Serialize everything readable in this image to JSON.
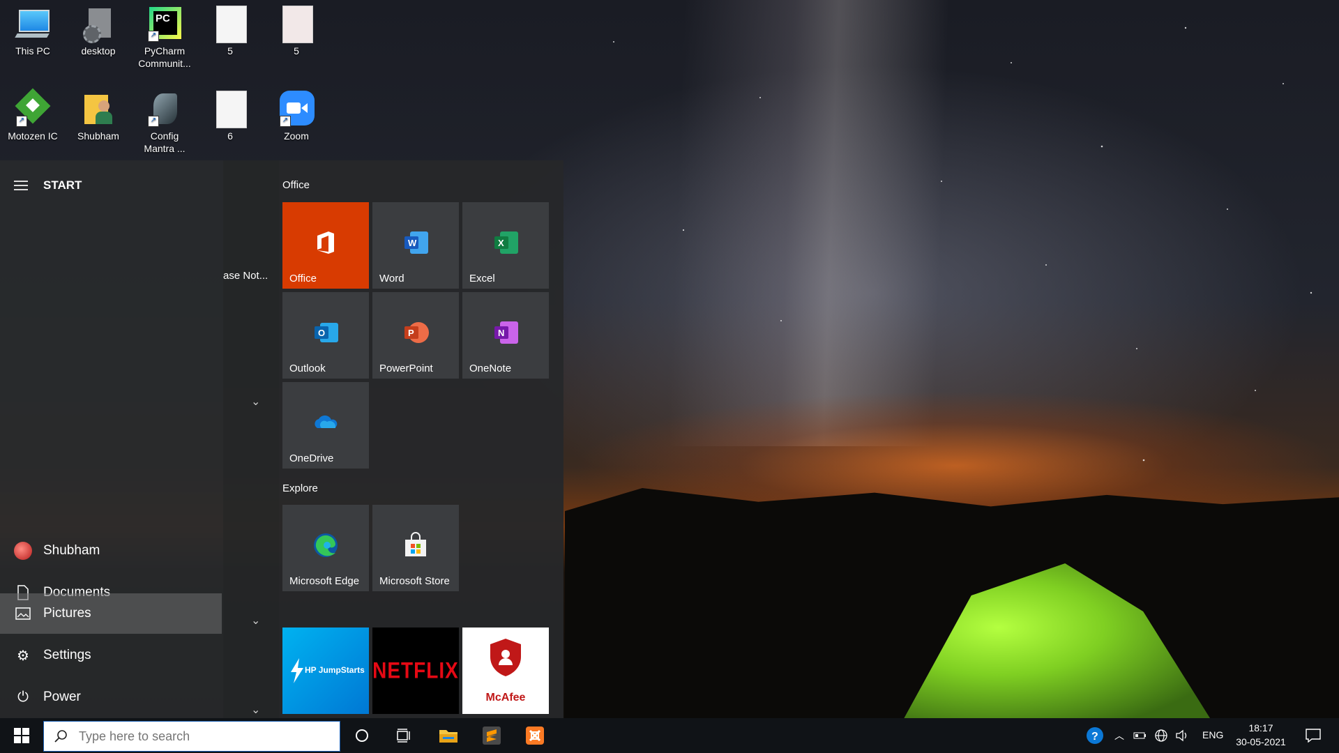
{
  "desktop": {
    "icons": [
      {
        "label": "This PC"
      },
      {
        "label": "desktop"
      },
      {
        "label": "PyCharm Communit..."
      },
      {
        "label": "5"
      },
      {
        "label": "5"
      },
      {
        "label": "Motozen IC"
      },
      {
        "label": "Shubham"
      },
      {
        "label": "Config Mantra ..."
      },
      {
        "label": "6"
      },
      {
        "label": "Zoom"
      }
    ]
  },
  "start": {
    "title": "START",
    "partial_app": "ase Not...",
    "nav": {
      "user": "Shubham",
      "documents": "Documents",
      "pictures": "Pictures",
      "settings": "Settings",
      "power": "Power"
    },
    "groups": {
      "office": {
        "title": "Office",
        "tiles": [
          "Office",
          "Word",
          "Excel",
          "Outlook",
          "PowerPoint",
          "OneNote",
          "OneDrive"
        ]
      },
      "explore": {
        "title": "Explore",
        "tiles": [
          "Microsoft Edge",
          "Microsoft Store"
        ]
      },
      "promo": [
        "HP JumpStarts",
        "NETFLIX",
        "McAfee"
      ]
    }
  },
  "taskbar": {
    "search_placeholder": "Type here to search",
    "lang": "ENG",
    "time": "18:17",
    "date": "30-05-2021"
  },
  "colors": {
    "office_tile": "#d83b01",
    "netflix_text": "#e50914",
    "hp_tile": "#0096d6",
    "mcafee_red": "#c01818"
  }
}
